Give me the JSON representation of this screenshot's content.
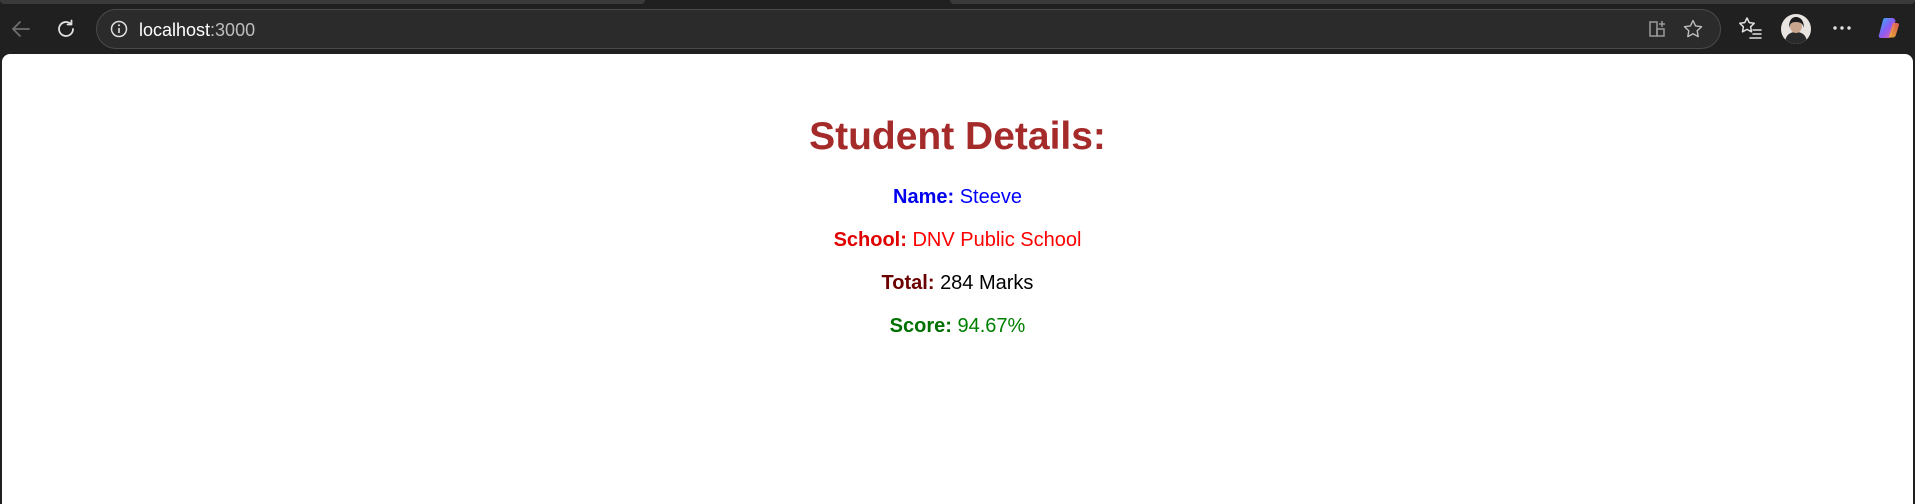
{
  "browser": {
    "url_host": "localhost",
    "url_port": ":3000"
  },
  "page": {
    "title": "Student Details:",
    "fields": [
      {
        "label": "Name:",
        "value": "Steeve",
        "label_color": "#0000ee",
        "value_color": "#0000ff"
      },
      {
        "label": "School:",
        "value": "DNV Public School",
        "label_color": "#e00000",
        "value_color": "#ff0000"
      },
      {
        "label": "Total:",
        "value": "284 Marks",
        "label_color": "#6b0000",
        "value_color": "#000000"
      },
      {
        "label": "Score:",
        "value": "94.67%",
        "label_color": "#007000",
        "value_color": "#008000"
      }
    ]
  },
  "colors": {
    "title": "#a52a2a",
    "chrome_bg": "#202020",
    "page_bg": "#ffffff"
  }
}
